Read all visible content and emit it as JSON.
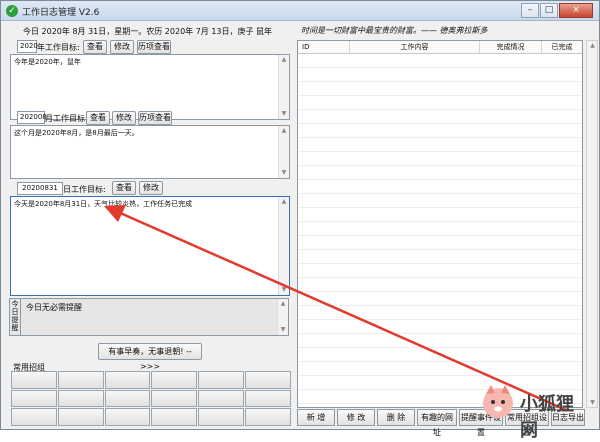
{
  "window": {
    "title": "工作日志管理 V2.6",
    "minimize": "–",
    "maximize": "□",
    "close": "×"
  },
  "date_line": "今日 2020年 8月 31日，星期一。农历 2020年 7月 13日，庚子 鼠年",
  "quote": "时间是一切财富中最宝贵的财富。—— 德奥弗拉斯多",
  "year": {
    "field": "2020",
    "label": "年工作目标:",
    "view": "查看",
    "edit": "修改",
    "history": "历项查看",
    "text": "今年是2020年，鼠年"
  },
  "month": {
    "field": "202008",
    "label": "月工作目标:",
    "view": "查看",
    "edit": "修改",
    "history": "历项查看",
    "text": "这个月是2020年8月，是8月最后一天。"
  },
  "day": {
    "field": "20200831",
    "label": "日工作目标:",
    "view": "查看",
    "edit": "修改",
    "text": "今天是2020年8月31日，天气比较炎热，工作任务已完成"
  },
  "reminder": {
    "side_label": "今日提醒",
    "text": "今日无必需提醒"
  },
  "motto_button": "有事早奏，无事退朝! -->>>",
  "common_tools_label": "常用招组",
  "table": {
    "headers": [
      "ID",
      "工作内容",
      "完成情况",
      "已完成"
    ]
  },
  "bottom_buttons": [
    "新 增",
    "修 改",
    "删 除",
    "有趣的网址",
    "提醒事件设置",
    "常用招组设置",
    "日志导出"
  ],
  "watermark": {
    "text": "小狐狸网"
  },
  "colors": {
    "annotation_arrow": "#e23b2e",
    "title_icon": "#2f9e3a"
  }
}
